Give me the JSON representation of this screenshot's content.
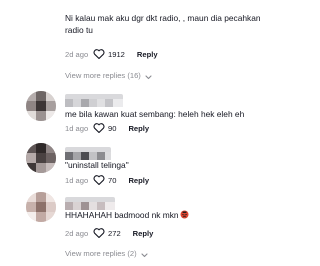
{
  "comments": [
    {
      "text": "Ni kalau mak aku dgr dkt radio, , maun dia pecahkan\nradio tu",
      "date": "2d ago",
      "likes": "1912",
      "reply_label": "Reply",
      "view_more": "View more replies (16)"
    },
    {
      "text": "me bila kawan kuat sembang: heleh hek eleh eh",
      "date": "1d ago",
      "likes": "90",
      "reply_label": "Reply"
    },
    {
      "text": "\"uninstall telinga\"",
      "date": "1d ago",
      "likes": "70",
      "reply_label": "Reply"
    },
    {
      "text": "HHAHAHAH badmood nk mkn",
      "emoji": "angry-face-with-symbols",
      "date": "2d ago",
      "likes": "272",
      "reply_label": "Reply",
      "view_more": "View more replies (2)"
    }
  ],
  "icons": {
    "like": "heart-outline-icon",
    "expand": "chevron-down-icon"
  },
  "colors": {
    "text": "#161823",
    "muted": "#8a8b91",
    "background": "#ffffff"
  }
}
